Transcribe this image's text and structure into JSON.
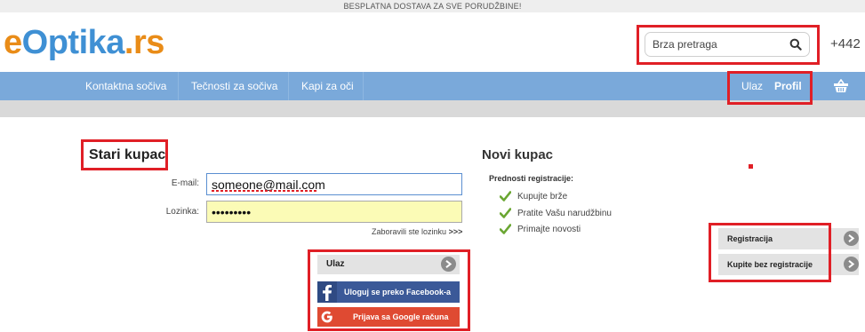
{
  "topbar": {
    "text": "BESPLATNA DOSTAVA ZA SVE PORUDŽBINE!"
  },
  "logo": {
    "part1": "e",
    "part2": "Optika",
    "part3": ".rs"
  },
  "search": {
    "placeholder": "Brza pretraga"
  },
  "header": {
    "phone": "+442"
  },
  "nav": {
    "items": [
      {
        "label": "Kontaktna sočiva"
      },
      {
        "label": "Tečnosti za sočiva"
      },
      {
        "label": "Kapi za oči"
      }
    ],
    "login": "Ulaz",
    "profile": "Profil"
  },
  "old_customer": {
    "title": "Stari kupac",
    "email_label": "E-mail:",
    "email_value": "someone@mail.com",
    "password_label": "Lozinka:",
    "password_value": "password1",
    "forgot_text": "Zaboravili ste lozinku",
    "forgot_arrows": ">>>",
    "login_button": "Ulaz",
    "facebook_button": "Uloguj se preko Facebook-a",
    "google_button": "Prijava sa Google računa"
  },
  "new_customer": {
    "title": "Novi kupac",
    "benefits_title": "Prednosti registracije:",
    "benefits": [
      {
        "text": "Kupujte brže"
      },
      {
        "text": "Pratite Vašu narudžbinu"
      },
      {
        "text": "Primajte novosti"
      }
    ],
    "register_button": "Registracija",
    "guest_button": "Kupite bez registracije"
  },
  "colors": {
    "nav_bg": "#7aa9da",
    "logo_orange": "#e98c18",
    "logo_blue": "#3f90d4",
    "highlight_red": "#e01f26",
    "facebook_blue": "#3b5998",
    "google_red": "#df4a32"
  }
}
